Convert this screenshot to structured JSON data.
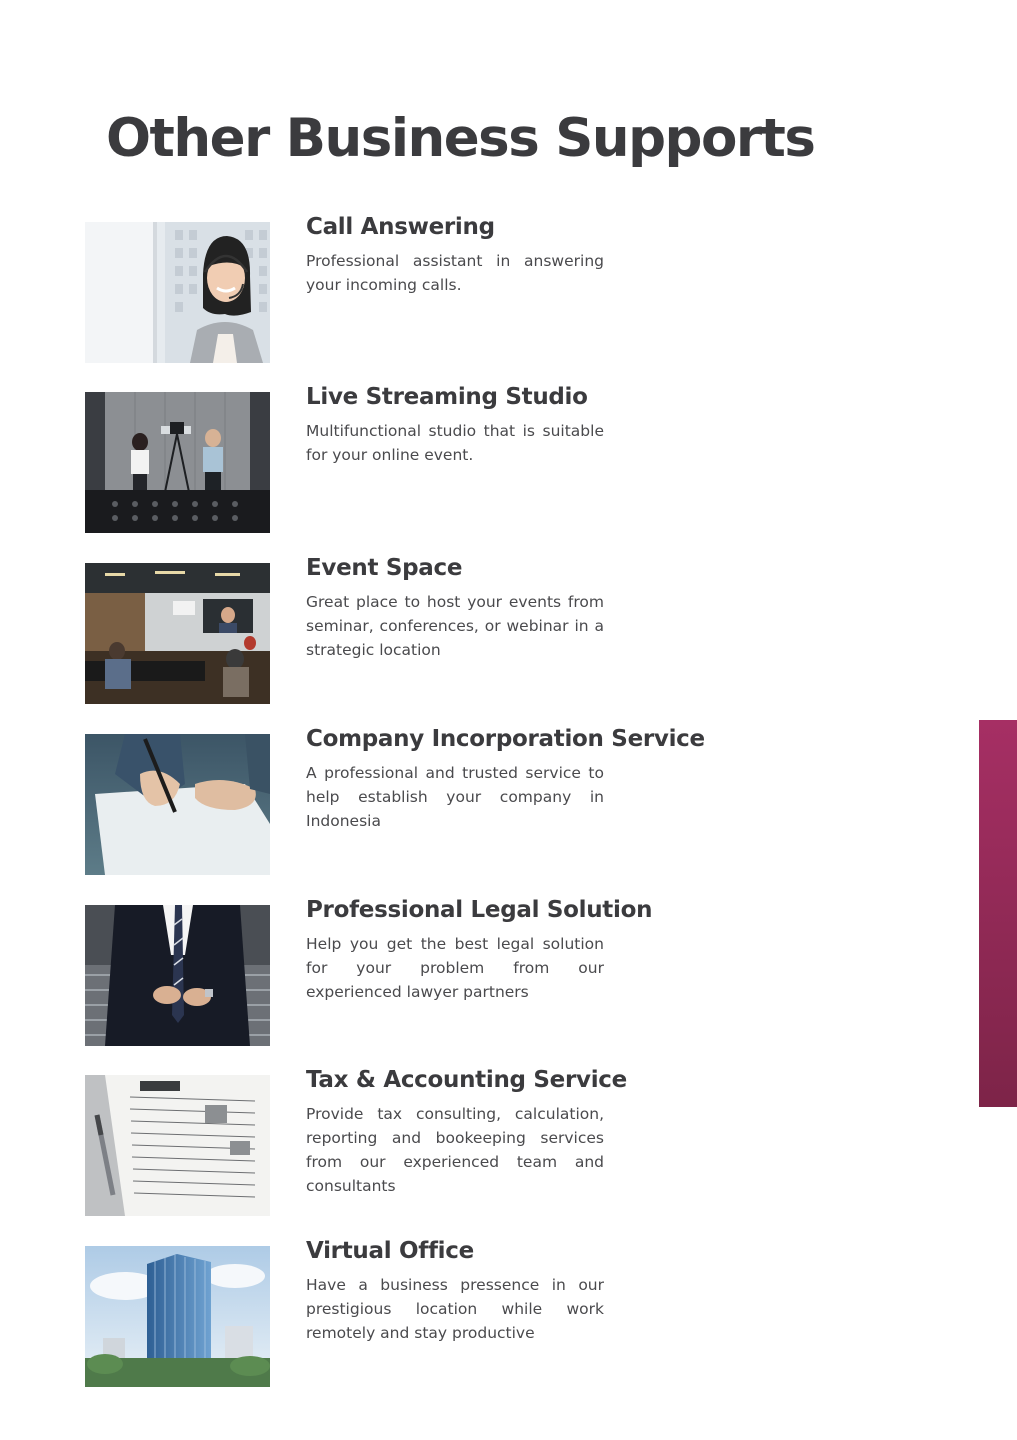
{
  "page": {
    "title": "Other Business Supports",
    "accent_color": "#a62f64"
  },
  "services": [
    {
      "title": "Call Answering",
      "description": "Professional assistant in answering your incoming calls.",
      "image": "call-answering-photo"
    },
    {
      "title": "Live Streaming Studio",
      "description": "Multifunctional studio that is suitable for your online event.",
      "image": "live-streaming-studio-photo"
    },
    {
      "title": "Event Space",
      "description": "Great place to host your events from seminar, conferences, or webinar in a strategic location",
      "image": "event-space-photo"
    },
    {
      "title": "Company Incorporation Service",
      "description": "A professional and trusted service to help establish your company in Indonesia",
      "image": "contract-signing-photo"
    },
    {
      "title": "Professional Legal Solution",
      "description": "Help you get the best legal solution for your problem from our experienced lawyer partners",
      "image": "businessman-photo"
    },
    {
      "title": "Tax & Accounting Service",
      "description": "Provide tax consulting, calculation, reporting and bookeeping services from our experienced team and consultants",
      "image": "tax-forms-photo"
    },
    {
      "title": "Virtual Office",
      "description": "Have a business pressence in our prestigious location while work remotely and stay productive",
      "image": "office-tower-photo"
    }
  ]
}
